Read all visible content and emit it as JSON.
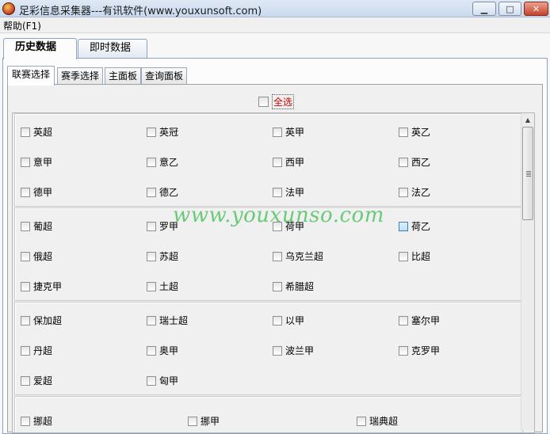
{
  "window": {
    "title": "足彩信息采集器---有讯软件(www.youxunsoft.com)",
    "minimize_glyph": "▁",
    "maximize_glyph": "□",
    "close_glyph": "✕"
  },
  "menu": {
    "help": "帮助(F1)"
  },
  "outer_tabs": [
    "历史数据",
    "即时数据"
  ],
  "inner_tabs": [
    "联赛选择",
    "赛季选择",
    "主面板",
    "查询面板"
  ],
  "select_all": "全选",
  "groups": [
    {
      "rows": [
        [
          "英超",
          "英冠",
          "英甲",
          "英乙"
        ],
        [
          "意甲",
          "意乙",
          "西甲",
          "西乙"
        ],
        [
          "德甲",
          "德乙",
          "法甲",
          "法乙"
        ]
      ]
    },
    {
      "rows": [
        [
          "葡超",
          "罗甲",
          "荷甲",
          "荷乙"
        ],
        [
          "俄超",
          "苏超",
          "乌克兰超",
          "比超"
        ],
        [
          "捷克甲",
          "土超",
          "希腊超"
        ]
      ]
    },
    {
      "rows": [
        [
          "保加超",
          "瑞士超",
          "以甲",
          "塞尔甲"
        ],
        [
          "丹超",
          "奥甲",
          "波兰甲",
          "克罗甲"
        ],
        [
          "爱超",
          "匈甲"
        ]
      ]
    },
    {
      "rows": [
        [
          "挪超",
          "挪甲",
          "瑞典超"
        ]
      ]
    }
  ],
  "watermark": "www.youxunso.com",
  "colors": {
    "watermark": "#3cbe50",
    "select_all": "#cc0000"
  }
}
